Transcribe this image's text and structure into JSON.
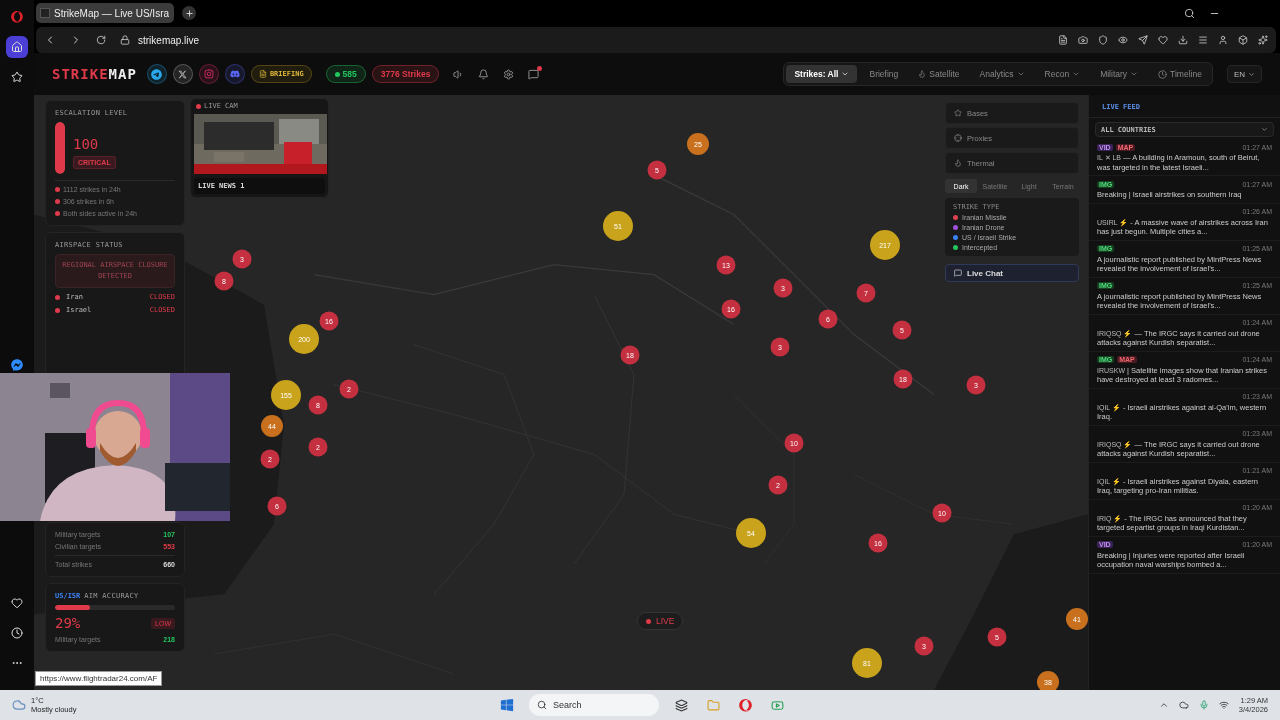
{
  "browser": {
    "sidebar": [
      {
        "kind": "logo",
        "selected": false
      },
      {
        "kind": "home",
        "selected": true
      },
      {
        "kind": "star",
        "selected": false
      },
      {
        "kind": "messenger",
        "selected": false
      },
      {
        "kind": "heart",
        "selected": false
      },
      {
        "kind": "clock",
        "selected": false
      },
      {
        "kind": "more",
        "selected": false
      }
    ],
    "tabs": [
      {
        "title": "StrikeMap — Live US/Isra",
        "selected": true
      }
    ],
    "url": "strikemap.live"
  },
  "header": {
    "logo": [
      "STRIKE",
      "MAP"
    ],
    "briefing": "BRIEFING",
    "online": "585",
    "strikes": "3776 Strikes",
    "nav": [
      {
        "label": "Strikes: All",
        "selected": true,
        "dropdown": true
      },
      {
        "label": "Briefing",
        "selected": false,
        "dropdown": false
      },
      {
        "label": "Satellite",
        "selected": false,
        "dropdown": false
      },
      {
        "label": "Analytics",
        "selected": false,
        "dropdown": true
      },
      {
        "label": "Recon",
        "selected": false,
        "dropdown": true
      },
      {
        "label": "Military",
        "selected": false,
        "dropdown": true
      },
      {
        "label": "Timeline",
        "selected": false,
        "dropdown": false
      }
    ],
    "language": "EN"
  },
  "escalation": {
    "title": "ESCALATION LEVEL",
    "level": 1,
    "value": "100",
    "status": "CRITICAL",
    "facts": [
      "1112 strikes in 24h",
      "306 strikes in 6h",
      "Both sides active in 24h"
    ]
  },
  "airspace": {
    "title": "AIRSPACE STATUS",
    "alert": "REGIONAL AIRSPACE CLOSURE DETECTED",
    "countries": [
      {
        "name": "Iran",
        "status": "CLOSED"
      },
      {
        "name": "Israel",
        "status": "CLOSED"
      }
    ]
  },
  "targets": {
    "rows": [
      {
        "label": "Military targets",
        "value": "107",
        "kind": "good"
      },
      {
        "label": "Civilian targets",
        "value": "553",
        "kind": "bad"
      },
      {
        "label": "Total strikes",
        "value": "660",
        "kind": "total"
      }
    ]
  },
  "accuracy": {
    "title_lead": "US/ISR",
    "title": "AIM ACCURACY",
    "level": 0.29,
    "value": "29%",
    "rating": "LOW",
    "rows": [
      {
        "label": "Military targets",
        "value": "218",
        "kind": "good"
      }
    ]
  },
  "live_cam": {
    "title": "LIVE CAM",
    "channel": "LIVE NEWS 1"
  },
  "map": {
    "live": "LIVE",
    "markers": [
      {
        "value": "5",
        "color": "#c4303f"
      },
      {
        "value": "25",
        "color": "#c8701e"
      },
      {
        "value": "51",
        "color": "#c9a31c"
      },
      {
        "value": "217",
        "color": "#c9a31c"
      },
      {
        "value": "13",
        "color": "#c4303f"
      },
      {
        "value": "3",
        "color": "#c4303f"
      },
      {
        "value": "7",
        "color": "#c4303f"
      },
      {
        "value": "16",
        "color": "#c4303f"
      },
      {
        "value": "6",
        "color": "#c4303f"
      },
      {
        "value": "5",
        "color": "#c4303f"
      },
      {
        "value": "3",
        "color": "#c4303f"
      },
      {
        "value": "8",
        "color": "#c4303f"
      },
      {
        "value": "16",
        "color": "#c4303f"
      },
      {
        "value": "200",
        "color": "#c9a31c"
      },
      {
        "value": "2",
        "color": "#c4303f"
      },
      {
        "value": "155",
        "color": "#c9a31c"
      },
      {
        "value": "8",
        "color": "#c4303f"
      },
      {
        "value": "44",
        "color": "#c8701e"
      },
      {
        "value": "2",
        "color": "#c4303f"
      },
      {
        "value": "2",
        "color": "#c4303f"
      },
      {
        "value": "6",
        "color": "#c4303f"
      },
      {
        "value": "18",
        "color": "#c4303f"
      },
      {
        "value": "3",
        "color": "#c4303f"
      },
      {
        "value": "18",
        "color": "#c4303f"
      },
      {
        "value": "3",
        "color": "#c4303f"
      },
      {
        "value": "10",
        "color": "#c4303f"
      },
      {
        "value": "2",
        "color": "#c4303f"
      },
      {
        "value": "54",
        "color": "#c9a31c"
      },
      {
        "value": "10",
        "color": "#c4303f"
      },
      {
        "value": "16",
        "color": "#c4303f"
      },
      {
        "value": "5",
        "color": "#c4303f"
      },
      {
        "value": "3",
        "color": "#c4303f"
      },
      {
        "value": "81",
        "color": "#c9a31c"
      },
      {
        "value": "41",
        "color": "#c8701e"
      },
      {
        "value": "38",
        "color": "#c8701e"
      }
    ]
  },
  "layers": {
    "toggles": [
      "Bases",
      "Proxies",
      "Thermal"
    ],
    "styles": [
      {
        "label": "Dark",
        "selected": true
      },
      {
        "label": "Satellite",
        "selected": false
      },
      {
        "label": "Light",
        "selected": false
      },
      {
        "label": "Terrain",
        "selected": false
      }
    ],
    "legend_title": "STRIKE TYPE",
    "legend": [
      {
        "label": "Iranian Missile",
        "color": "#e0404f"
      },
      {
        "label": "Iranian Drone",
        "color": "#a050e0"
      },
      {
        "label": "US / Israeli Strike",
        "color": "#3b82f6"
      },
      {
        "label": "Intercepted",
        "color": "#22c55e"
      }
    ],
    "chat": "Live Chat"
  },
  "feed": {
    "title": "LIVE FEED",
    "filter": "ALL COUNTRIES",
    "items": [
      {
        "tags": [
          {
            "label": "VID",
            "kind": "video"
          },
          {
            "label": "MAP",
            "kind": "map"
          }
        ],
        "time": "01:27 AM",
        "flags": "IL ✕ LB",
        "text": "— A building in Aramoun, south of Beirut, was targeted in the latest Israeli..."
      },
      {
        "tags": [
          {
            "label": "IMG"
          }
        ],
        "time": "01:27 AM",
        "text": "Breaking | Israeli airstrikes on southern Iraq"
      },
      {
        "time": "01:26 AM",
        "flags": "USIRL ⚡",
        "text": "- A massive wave of airstrikes across Iran has just begun. Multiple cities a..."
      },
      {
        "tags": [
          {
            "label": "IMG"
          }
        ],
        "time": "01:25 AM",
        "text": "A journalistic report published by MintPress News revealed the involvement of Israel's..."
      },
      {
        "tags": [
          {
            "label": "IMG"
          }
        ],
        "time": "01:25 AM",
        "text": "A journalistic report published by MintPress News revealed the involvement of Israel's..."
      },
      {
        "time": "01:24 AM",
        "flags": "IRIQSQ ⚡",
        "text": "— The IRGC says it carried out drone attacks against Kurdish separatist..."
      },
      {
        "tags": [
          {
            "label": "IMG"
          },
          {
            "label": "MAP",
            "kind": "map"
          }
        ],
        "time": "01:24 AM",
        "flags": "IRUSKW",
        "text": "| Satellite images show that Iranian strikes have destroyed at least 3 radomes..."
      },
      {
        "time": "01:23 AM",
        "flags": "IQIL ⚡",
        "text": "- Israeli airstrikes against al-Qa'im, western Iraq."
      },
      {
        "time": "01:23 AM",
        "flags": "IRIQSQ ⚡",
        "text": "— The IRGC says it carried out drone attacks against Kurdish separatist..."
      },
      {
        "time": "01:21 AM",
        "flags": "IQIL ⚡",
        "text": "- Israeli airstrikes against Diyala, eastern Iraq, targeting pro-Iran militias."
      },
      {
        "time": "01:20 AM",
        "flags": "IRIQ ⚡",
        "text": "- The IRGC has announced that they targeted separtist groups in Iraqi Kurdistan..."
      },
      {
        "tags": [
          {
            "label": "VID",
            "kind": "video"
          }
        ],
        "time": "01:20 AM",
        "text": "Breaking | Injuries were reported after Israeli occupation naval warships bombed a..."
      }
    ]
  },
  "tooltip": "https://www.flightradar24.com/AF",
  "taskbar": {
    "temperature": "1°C",
    "condition": "Mostly cloudy",
    "search": "Search",
    "time": "1:29 AM",
    "date": "3/4/2026"
  }
}
